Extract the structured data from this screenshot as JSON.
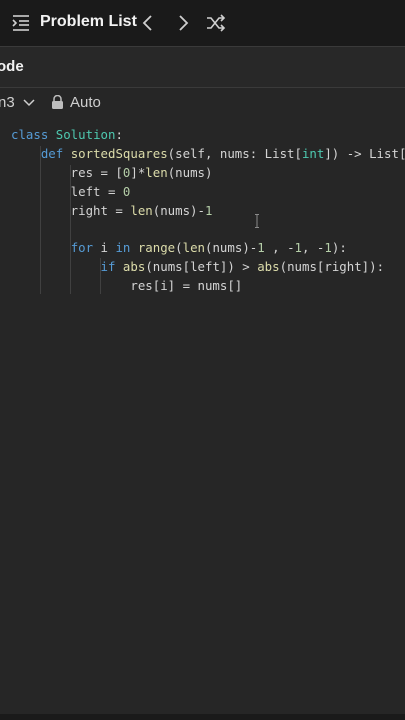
{
  "header": {
    "title": "Problem List",
    "icons": [
      "list-icon",
      "chevron-left-icon",
      "chevron-right-icon",
      "shuffle-icon"
    ]
  },
  "panel": {
    "title": "ode"
  },
  "toolbar": {
    "language": "n3",
    "mode": "Auto"
  },
  "code": {
    "lines": [
      [
        [
          "kw",
          "class "
        ],
        [
          "cls",
          "Solution"
        ],
        [
          "",
          ":"
        ]
      ],
      [
        [
          "",
          "    "
        ],
        [
          "kw",
          "def "
        ],
        [
          "fn",
          "sortedSquares"
        ],
        [
          "",
          "(self, nums: List["
        ],
        [
          "cls",
          "int"
        ],
        [
          "",
          "]) -> List["
        ]
      ],
      [
        [
          "",
          "        res = ["
        ],
        [
          "num",
          "0"
        ],
        [
          "",
          "]*"
        ],
        [
          "fn",
          "len"
        ],
        [
          "",
          "(nums)"
        ]
      ],
      [
        [
          "",
          "        left = "
        ],
        [
          "num",
          "0"
        ]
      ],
      [
        [
          "",
          "        right = "
        ],
        [
          "fn",
          "len"
        ],
        [
          "",
          "(nums)-"
        ],
        [
          "num",
          "1"
        ]
      ],
      [
        [
          "",
          ""
        ]
      ],
      [
        [
          "",
          "        "
        ],
        [
          "kw",
          "for "
        ],
        [
          "",
          "i "
        ],
        [
          "kw",
          "in "
        ],
        [
          "fn",
          "range"
        ],
        [
          "",
          "("
        ],
        [
          "fn",
          "len"
        ],
        [
          "",
          "(nums)-"
        ],
        [
          "num",
          "1"
        ],
        [
          "",
          " , -"
        ],
        [
          "num",
          "1"
        ],
        [
          "",
          ", -"
        ],
        [
          "num",
          "1"
        ],
        [
          "",
          "):"
        ]
      ],
      [
        [
          "",
          "            "
        ],
        [
          "kw",
          "if "
        ],
        [
          "fn",
          "abs"
        ],
        [
          "",
          "(nums[left]) > "
        ],
        [
          "fn",
          "abs"
        ],
        [
          "",
          "(nums[right]):"
        ]
      ],
      [
        [
          "",
          "                res[i] = nums[]"
        ]
      ]
    ]
  }
}
